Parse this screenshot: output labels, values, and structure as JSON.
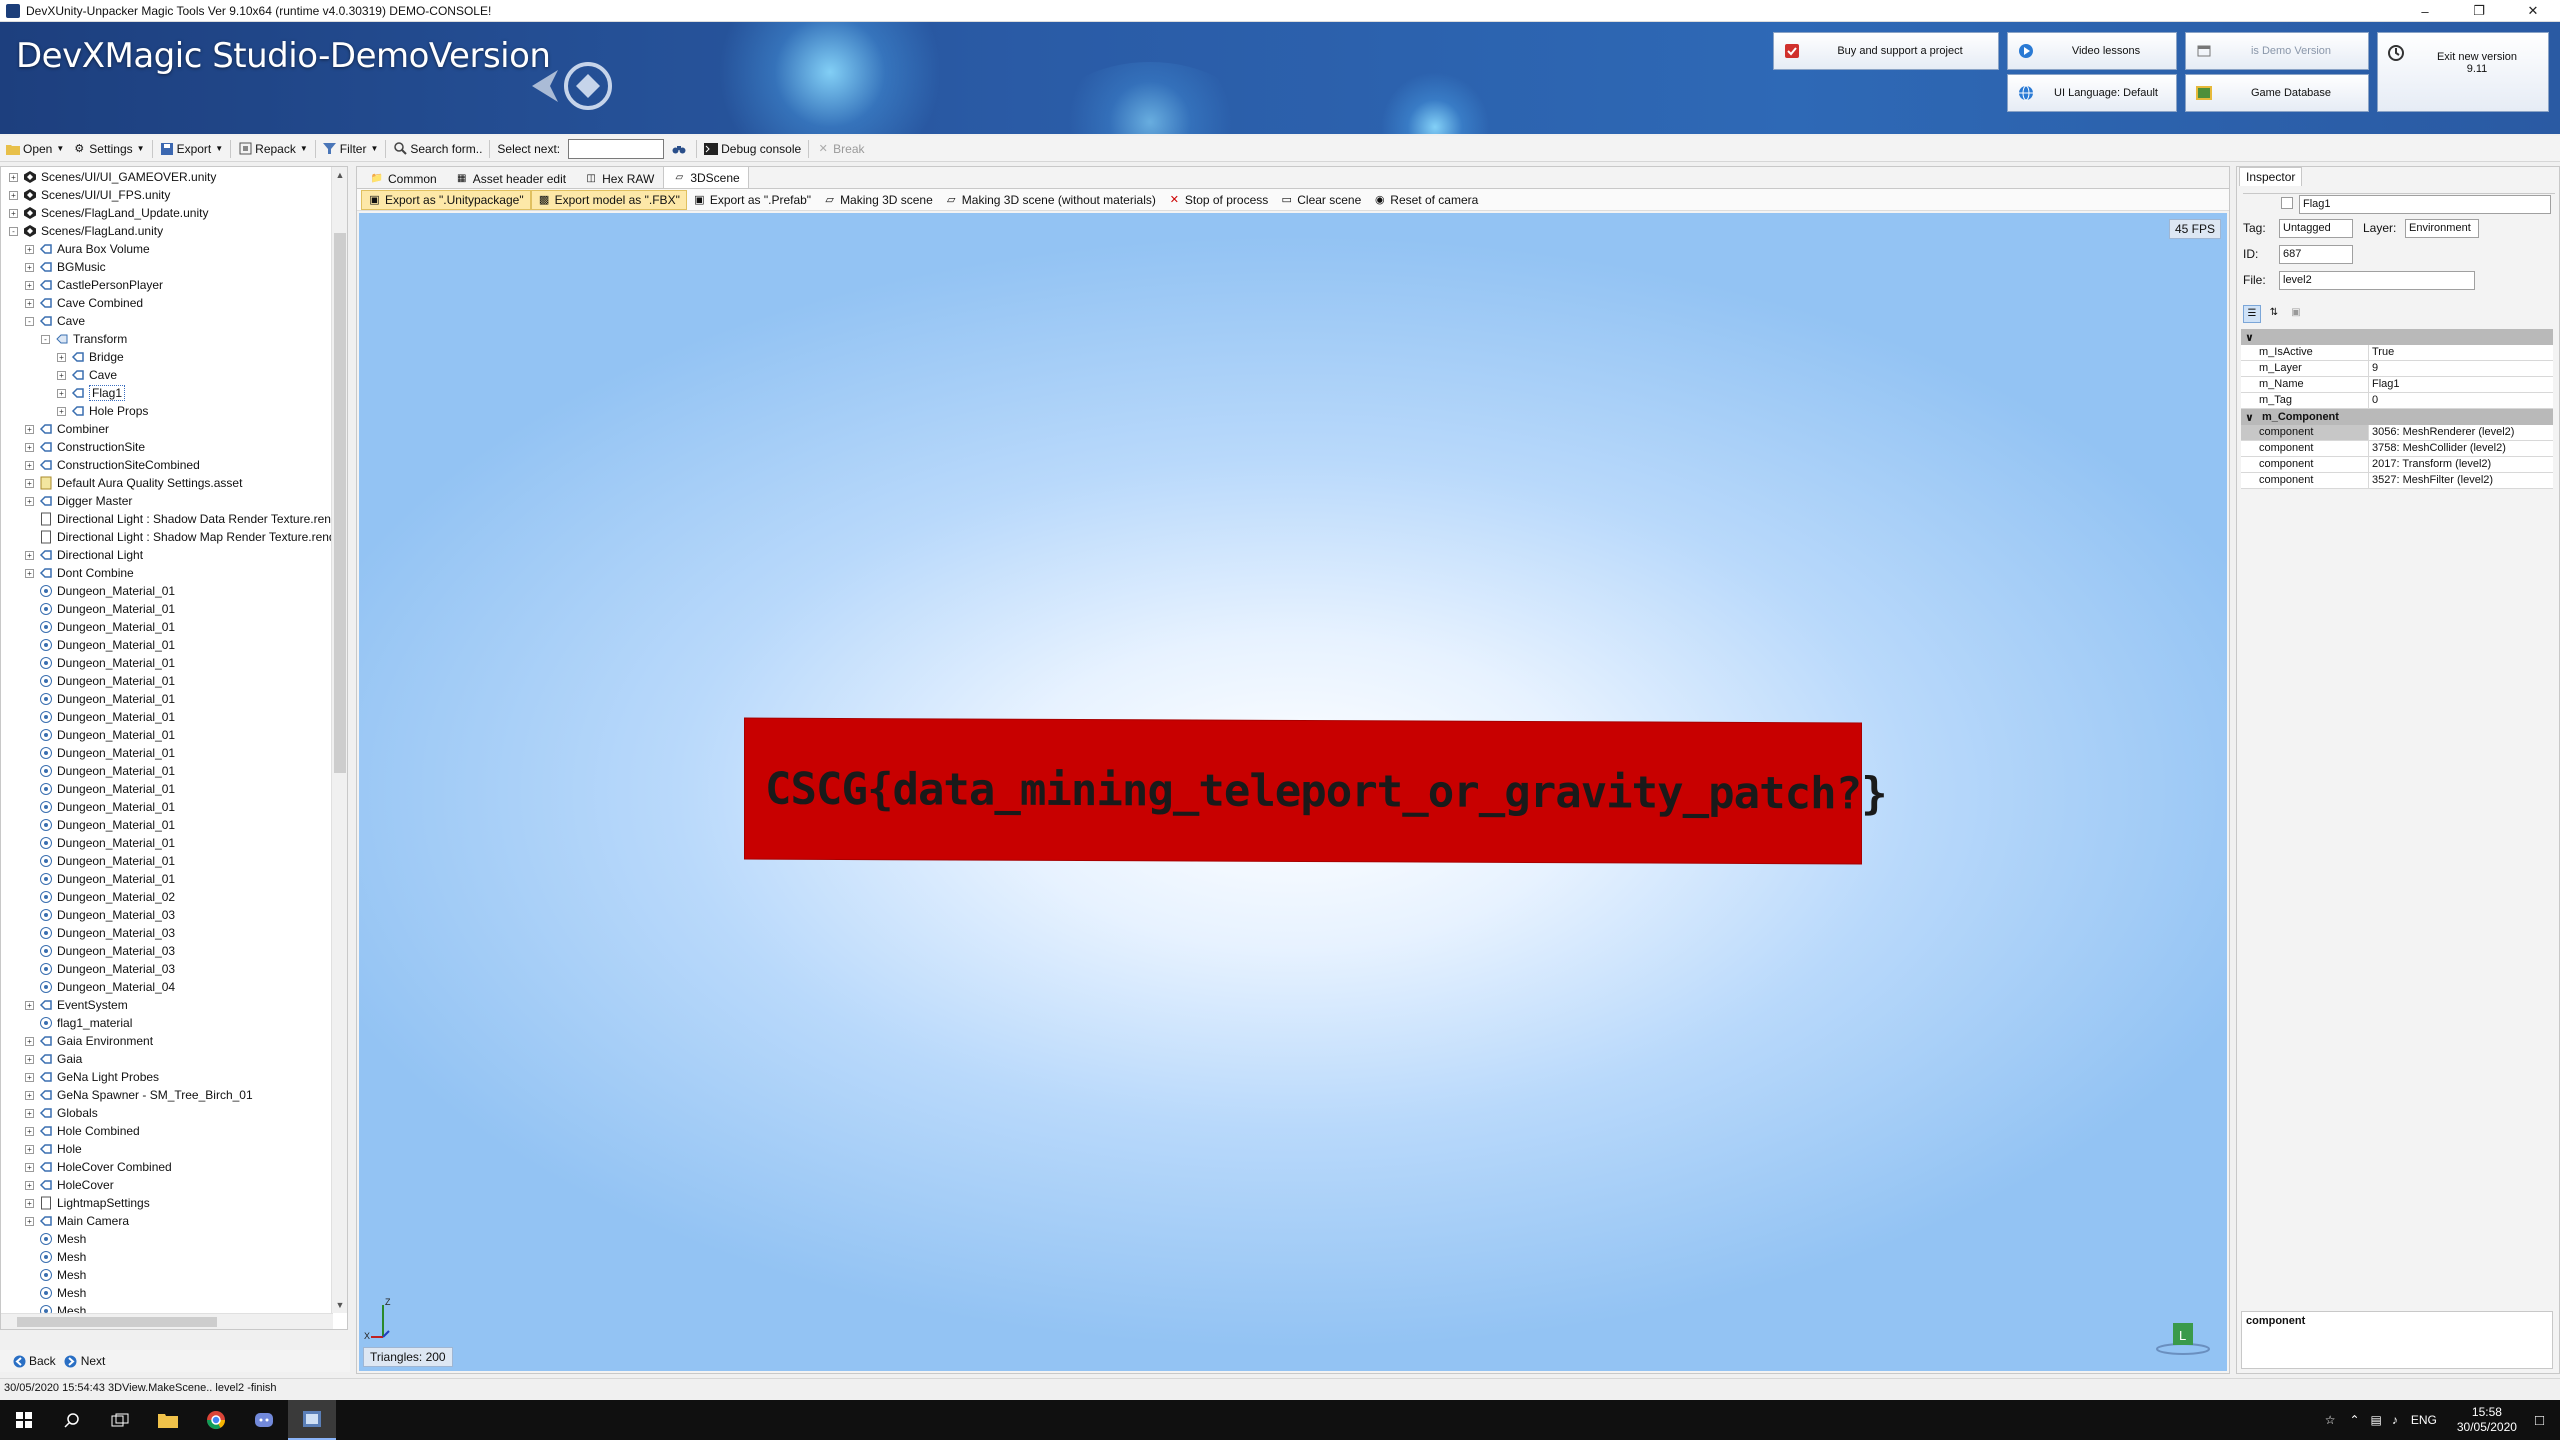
{
  "window": {
    "title": "DevXUnity-Unpacker Magic Tools Ver 9.10x64 (runtime v4.0.30319) DEMO-CONSOLE!",
    "controls": [
      "–",
      "❐",
      "✕"
    ]
  },
  "banner": {
    "logo_text": "DevXMagic Studio-DemoVersion",
    "buttons": {
      "buy": "Buy and support a project",
      "video": "Video lessons",
      "demo": "is Demo Version",
      "exit": "Exit new version\n9.11",
      "ui_language": "UI Language: Default",
      "game_db": "Game Database"
    }
  },
  "toolbar": {
    "open": "Open",
    "settings": "Settings",
    "export": "Export",
    "repack": "Repack",
    "filter": "Filter",
    "search": "Search form..",
    "select_next": "Select next:",
    "select_next_value": "",
    "debug_console": "Debug console",
    "break": "Break"
  },
  "tree": {
    "items": [
      {
        "label": "Scenes/UI/UI_GAMEOVER.unity",
        "indent": 1,
        "exp": "+",
        "icon": "unity-scene-icon"
      },
      {
        "label": "Scenes/UI/UI_FPS.unity",
        "indent": 1,
        "exp": "+",
        "icon": "unity-scene-icon"
      },
      {
        "label": "Scenes/FlagLand_Update.unity",
        "indent": 1,
        "exp": "+",
        "icon": "unity-scene-icon"
      },
      {
        "label": "Scenes/FlagLand.unity",
        "indent": 1,
        "exp": "-",
        "icon": "unity-scene-icon"
      },
      {
        "label": "Aura Box Volume",
        "indent": 2,
        "exp": "+",
        "icon": "gameobject-icon"
      },
      {
        "label": "BGMusic",
        "indent": 2,
        "exp": "+",
        "icon": "gameobject-icon"
      },
      {
        "label": "CastlePersonPlayer",
        "indent": 2,
        "exp": "+",
        "icon": "gameobject-icon"
      },
      {
        "label": "Cave Combined",
        "indent": 2,
        "exp": "+",
        "icon": "gameobject-icon"
      },
      {
        "label": "Cave",
        "indent": 2,
        "exp": "-",
        "icon": "gameobject-icon"
      },
      {
        "label": "Transform",
        "indent": 3,
        "exp": "-",
        "icon": "transform-icon"
      },
      {
        "label": "Bridge",
        "indent": 4,
        "exp": "+",
        "icon": "gameobject-icon"
      },
      {
        "label": "Cave",
        "indent": 4,
        "exp": "+",
        "icon": "gameobject-icon"
      },
      {
        "label": "Flag1",
        "indent": 4,
        "exp": "+",
        "icon": "gameobject-icon",
        "selected": true
      },
      {
        "label": "Hole Props",
        "indent": 4,
        "exp": "+",
        "icon": "gameobject-icon"
      },
      {
        "label": "Combiner",
        "indent": 2,
        "exp": "+",
        "icon": "gameobject-icon"
      },
      {
        "label": "ConstructionSite",
        "indent": 2,
        "exp": "+",
        "icon": "gameobject-icon"
      },
      {
        "label": "ConstructionSiteCombined",
        "indent": 2,
        "exp": "+",
        "icon": "gameobject-icon"
      },
      {
        "label": "Default Aura Quality Settings.asset",
        "indent": 2,
        "exp": "+",
        "icon": "asset-icon"
      },
      {
        "label": "Digger Master",
        "indent": 2,
        "exp": "+",
        "icon": "gameobject-icon"
      },
      {
        "label": "Directional Light : Shadow Data Render Texture.rend",
        "indent": 2,
        "exp": "",
        "icon": "file-icon"
      },
      {
        "label": "Directional Light : Shadow Map Render Texture.rend",
        "indent": 2,
        "exp": "",
        "icon": "file-icon"
      },
      {
        "label": "Directional Light",
        "indent": 2,
        "exp": "+",
        "icon": "gameobject-icon"
      },
      {
        "label": "Dont Combine",
        "indent": 2,
        "exp": "+",
        "icon": "gameobject-icon"
      },
      {
        "label": "Dungeon_Material_01",
        "indent": 2,
        "exp": "",
        "icon": "material-icon"
      },
      {
        "label": "Dungeon_Material_01",
        "indent": 2,
        "exp": "",
        "icon": "material-icon"
      },
      {
        "label": "Dungeon_Material_01",
        "indent": 2,
        "exp": "",
        "icon": "material-icon"
      },
      {
        "label": "Dungeon_Material_01",
        "indent": 2,
        "exp": "",
        "icon": "material-icon"
      },
      {
        "label": "Dungeon_Material_01",
        "indent": 2,
        "exp": "",
        "icon": "material-icon"
      },
      {
        "label": "Dungeon_Material_01",
        "indent": 2,
        "exp": "",
        "icon": "material-icon"
      },
      {
        "label": "Dungeon_Material_01",
        "indent": 2,
        "exp": "",
        "icon": "material-icon"
      },
      {
        "label": "Dungeon_Material_01",
        "indent": 2,
        "exp": "",
        "icon": "material-icon"
      },
      {
        "label": "Dungeon_Material_01",
        "indent": 2,
        "exp": "",
        "icon": "material-icon"
      },
      {
        "label": "Dungeon_Material_01",
        "indent": 2,
        "exp": "",
        "icon": "material-icon"
      },
      {
        "label": "Dungeon_Material_01",
        "indent": 2,
        "exp": "",
        "icon": "material-icon"
      },
      {
        "label": "Dungeon_Material_01",
        "indent": 2,
        "exp": "",
        "icon": "material-icon"
      },
      {
        "label": "Dungeon_Material_01",
        "indent": 2,
        "exp": "",
        "icon": "material-icon"
      },
      {
        "label": "Dungeon_Material_01",
        "indent": 2,
        "exp": "",
        "icon": "material-icon"
      },
      {
        "label": "Dungeon_Material_01",
        "indent": 2,
        "exp": "",
        "icon": "material-icon"
      },
      {
        "label": "Dungeon_Material_01",
        "indent": 2,
        "exp": "",
        "icon": "material-icon"
      },
      {
        "label": "Dungeon_Material_01",
        "indent": 2,
        "exp": "",
        "icon": "material-icon"
      },
      {
        "label": "Dungeon_Material_02",
        "indent": 2,
        "exp": "",
        "icon": "material-icon"
      },
      {
        "label": "Dungeon_Material_03",
        "indent": 2,
        "exp": "",
        "icon": "material-icon"
      },
      {
        "label": "Dungeon_Material_03",
        "indent": 2,
        "exp": "",
        "icon": "material-icon"
      },
      {
        "label": "Dungeon_Material_03",
        "indent": 2,
        "exp": "",
        "icon": "material-icon"
      },
      {
        "label": "Dungeon_Material_03",
        "indent": 2,
        "exp": "",
        "icon": "material-icon"
      },
      {
        "label": "Dungeon_Material_04",
        "indent": 2,
        "exp": "",
        "icon": "material-icon"
      },
      {
        "label": "EventSystem",
        "indent": 2,
        "exp": "+",
        "icon": "gameobject-icon"
      },
      {
        "label": "flag1_material",
        "indent": 2,
        "exp": "",
        "icon": "material-icon"
      },
      {
        "label": "Gaia Environment",
        "indent": 2,
        "exp": "+",
        "icon": "gameobject-icon"
      },
      {
        "label": "Gaia",
        "indent": 2,
        "exp": "+",
        "icon": "gameobject-icon"
      },
      {
        "label": "GeNa Light Probes",
        "indent": 2,
        "exp": "+",
        "icon": "gameobject-icon"
      },
      {
        "label": "GeNa Spawner - SM_Tree_Birch_01",
        "indent": 2,
        "exp": "+",
        "icon": "gameobject-icon"
      },
      {
        "label": "Globals",
        "indent": 2,
        "exp": "+",
        "icon": "gameobject-icon"
      },
      {
        "label": "Hole Combined",
        "indent": 2,
        "exp": "+",
        "icon": "gameobject-icon"
      },
      {
        "label": "Hole",
        "indent": 2,
        "exp": "+",
        "icon": "gameobject-icon"
      },
      {
        "label": "HoleCover Combined",
        "indent": 2,
        "exp": "+",
        "icon": "gameobject-icon"
      },
      {
        "label": "HoleCover",
        "indent": 2,
        "exp": "+",
        "icon": "gameobject-icon"
      },
      {
        "label": "LightmapSettings",
        "indent": 2,
        "exp": "+",
        "icon": "file-icon"
      },
      {
        "label": "Main Camera",
        "indent": 2,
        "exp": "+",
        "icon": "gameobject-icon"
      },
      {
        "label": "Mesh",
        "indent": 2,
        "exp": "",
        "icon": "material-icon"
      },
      {
        "label": "Mesh",
        "indent": 2,
        "exp": "",
        "icon": "material-icon"
      },
      {
        "label": "Mesh",
        "indent": 2,
        "exp": "",
        "icon": "material-icon"
      },
      {
        "label": "Mesh",
        "indent": 2,
        "exp": "",
        "icon": "material-icon"
      },
      {
        "label": "Mesh",
        "indent": 2,
        "exp": "",
        "icon": "material-icon"
      },
      {
        "label": "Mesh",
        "indent": 2,
        "exp": "",
        "icon": "material-icon"
      }
    ]
  },
  "nav": {
    "back": "Back",
    "next": "Next"
  },
  "tabs": [
    {
      "label": "Common",
      "icon": "folder-icon"
    },
    {
      "label": "Asset header edit",
      "icon": "grid-icon"
    },
    {
      "label": "Hex RAW",
      "icon": "hex-icon"
    },
    {
      "label": "3DScene",
      "icon": "cube-icon",
      "active": true
    }
  ],
  "scene_toolbar": [
    {
      "label": "Export as \".Unitypackage\"",
      "icon": "package-icon",
      "highlight": true
    },
    {
      "label": "Export model as \".FBX\"",
      "icon": "save-icon",
      "highlight": true
    },
    {
      "label": "Export as \".Prefab\"",
      "icon": "package-icon"
    },
    {
      "label": "Making 3D scene",
      "icon": "scene-icon"
    },
    {
      "label": "Making 3D scene (without materials)",
      "icon": "scene-icon"
    },
    {
      "label": "Stop of process",
      "icon": "stop-icon"
    },
    {
      "label": "Clear scene",
      "icon": "page-icon"
    },
    {
      "label": "Reset of camera",
      "icon": "camera-icon"
    }
  ],
  "viewport": {
    "fps": "45 FPS",
    "flag_text": "CSCG{data_mining_teleport_or_gravity_patch?}",
    "triangles": "Triangles: 200",
    "axis_labels": {
      "z": "Z",
      "x": "X"
    },
    "gizmo_label": "L"
  },
  "inspector": {
    "tab": "Inspector",
    "name_value": "Flag1",
    "tag_label": "Tag:",
    "tag_value": "Untagged",
    "layer_label": "Layer:",
    "layer_value": "Environment",
    "id_label": "ID:",
    "id_value": "687",
    "file_label": "File:",
    "file_value": "level2",
    "props": [
      {
        "k": "m_IsActive",
        "v": "True"
      },
      {
        "k": "m_Layer",
        "v": "9"
      },
      {
        "k": "m_Name",
        "v": "Flag1"
      },
      {
        "k": "m_Tag",
        "v": "0"
      }
    ],
    "component_category": "m_Component",
    "components": [
      {
        "k": "component",
        "v": "3056: MeshRenderer (level2)"
      },
      {
        "k": "component",
        "v": "3758: MeshCollider (level2)"
      },
      {
        "k": "component",
        "v": "2017: Transform (level2)"
      },
      {
        "k": "component",
        "v": "3527: MeshFilter (level2)"
      }
    ],
    "description_title": "component"
  },
  "status": "30/05/2020 15:54:43 3DView.MakeScene.. level2 -finish",
  "taskbar": {
    "lang": "ENG",
    "time": "15:58",
    "date": "30/05/2020"
  },
  "colors": {
    "flag": "#c80000",
    "banner": "#2a5ba6",
    "highlight": "#fde8a8"
  }
}
